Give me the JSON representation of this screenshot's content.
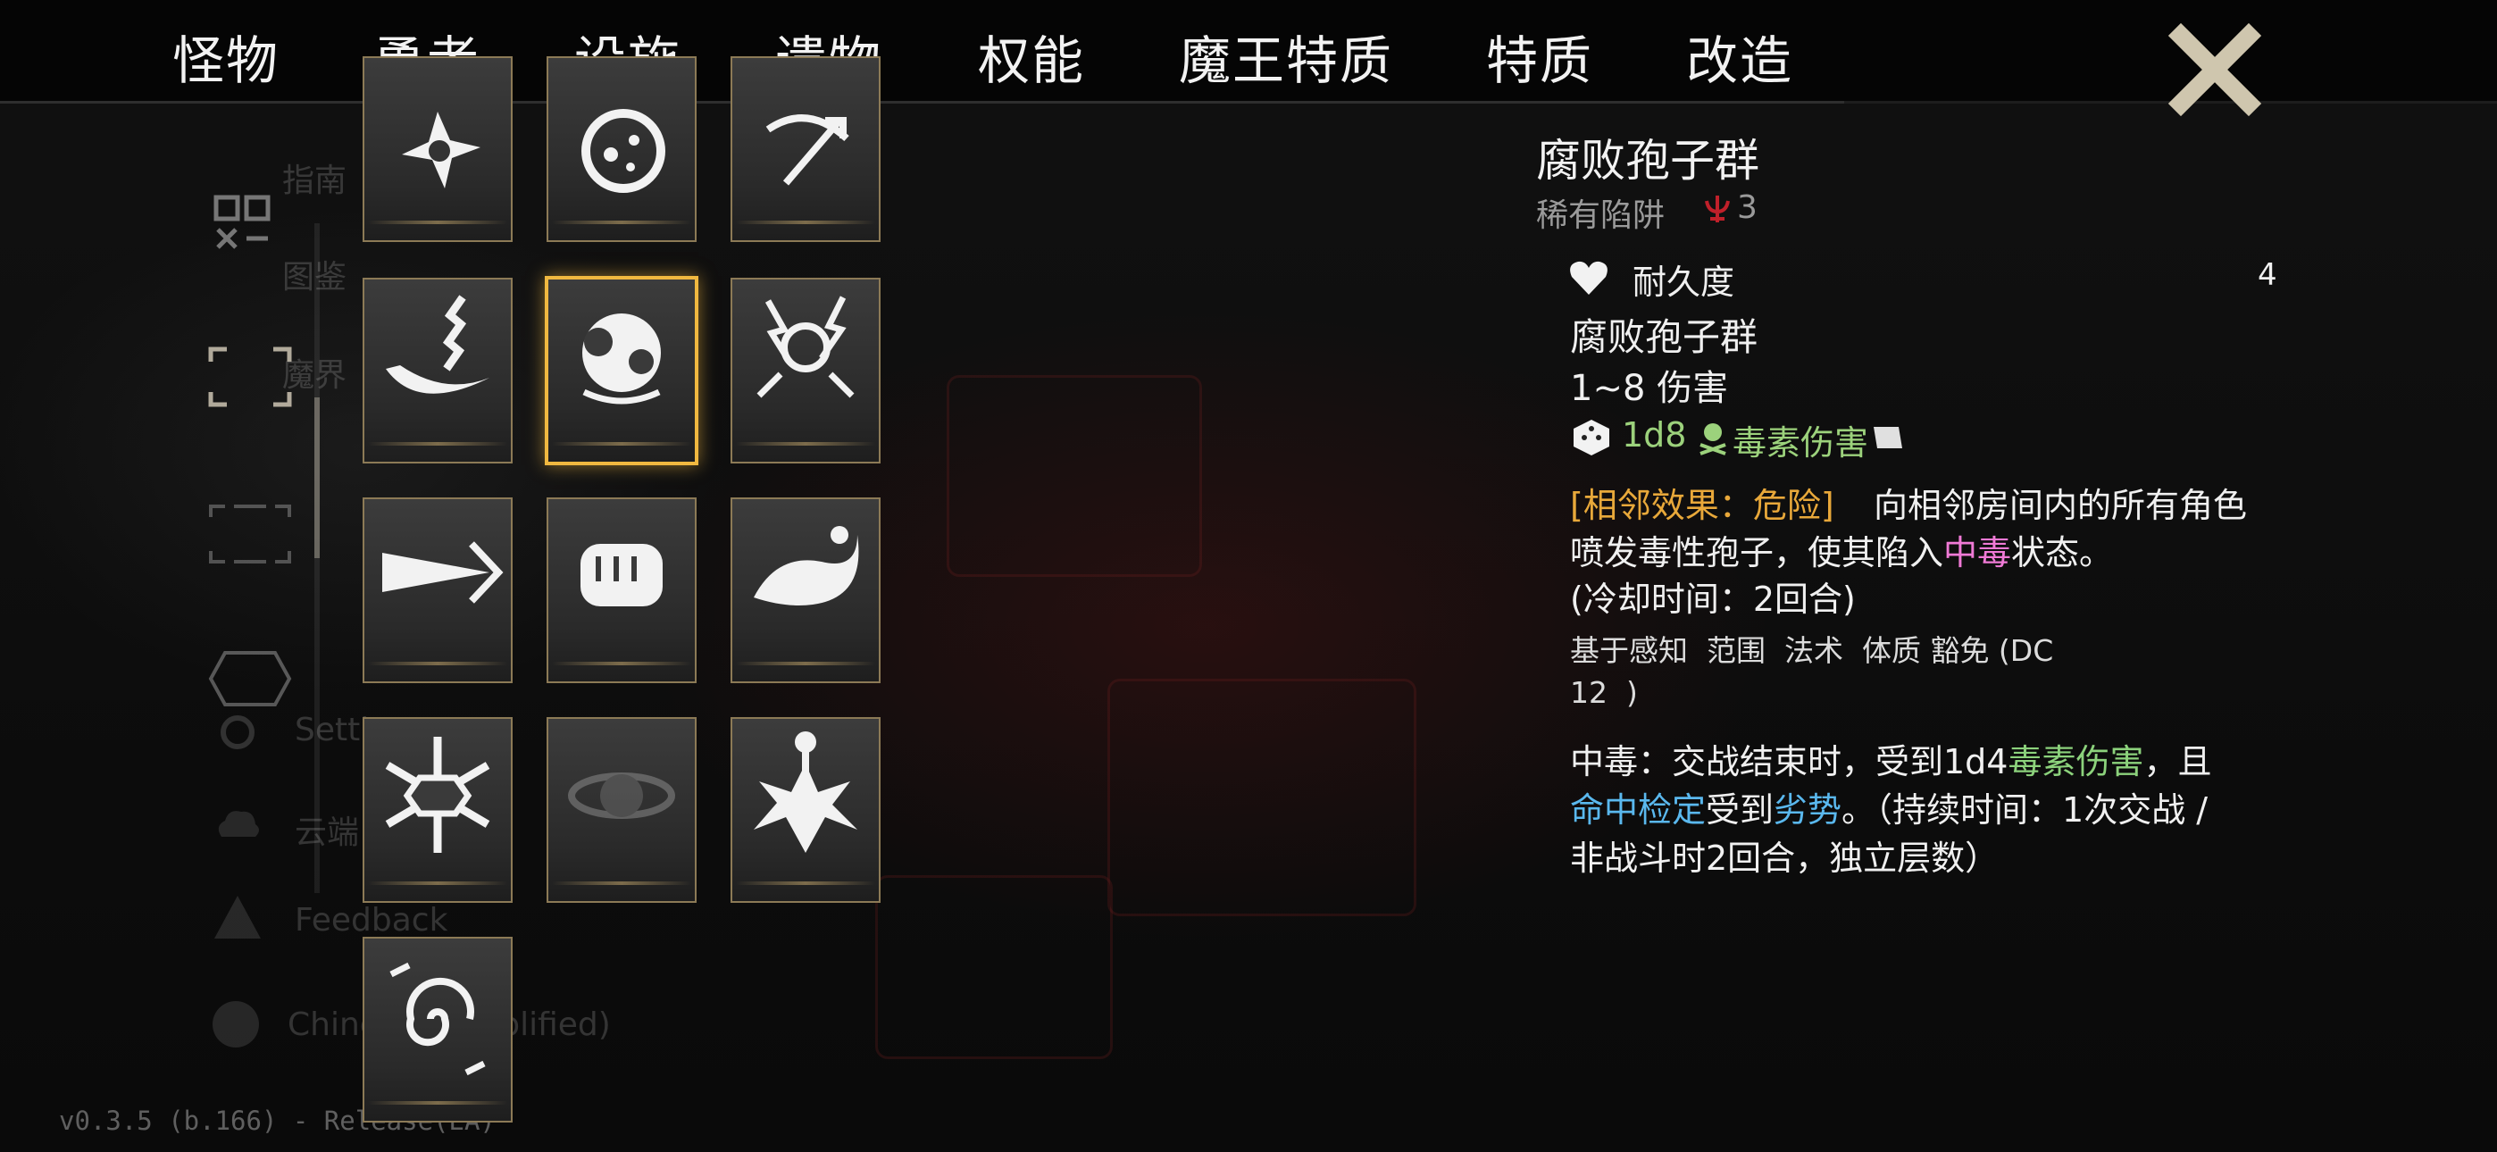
{
  "nav": {
    "tabs": [
      "怪物",
      "勇者",
      "设施",
      "遗物",
      "权能",
      "魔王特质",
      "特质",
      "改造"
    ],
    "active_tab": "设施"
  },
  "left_menu": {
    "items": [
      "指南",
      "图鉴",
      "魔界",
      "Settings",
      "云端",
      "Feedback",
      "Chinese (Simplified)"
    ]
  },
  "version": "v0.3.5 (b.166) - Release(EA)",
  "grid": {
    "icons": [
      "shuriken-trap-icon",
      "moon-orb-icon",
      "crossbow-icon",
      "chain-blade-icon",
      "spore-cloud-icon",
      "lightning-bolt-icon",
      "shockwave-icon",
      "fist-icon",
      "water-wave-icon",
      "snowflake-icon",
      "dark-vortex-icon",
      "explosion-icon",
      "spiral-portal-icon"
    ],
    "selected_index": 4
  },
  "detail": {
    "title": "腐败孢子群",
    "rarity": "稀有陷阱",
    "rarity_value": "3",
    "durability_label": "耐久度",
    "durability_value": "4",
    "attack_name": "腐败孢子群",
    "damage_text": "1~8 伤害",
    "dice": "1d8",
    "damage_type": "毒素伤害",
    "effect_tag": "[相邻效果：危险]",
    "effect_text_1": "向相邻房间内的所有角色",
    "effect_text_2a": "喷发毒性孢子，使其陷入",
    "effect_text_2b": "中毒",
    "effect_text_2c": "状态。",
    "cooldown": "(冷却时间：2回合)",
    "tag_perception": "基于感知",
    "tag_area": "范围",
    "tag_spell": "法术",
    "tag_save": "体质 豁免 (DC",
    "tag_save_dc": "12",
    "tag_close": ")",
    "poison_prefix": "中毒：交战结束时，受到1d4",
    "poison_dmg": "毒素伤害",
    "poison_suffix": "，且",
    "hit_check": "命中检定",
    "hit_mid": "受到",
    "disadvantage": "劣势",
    "hit_end": "。（持续时间：1次交战 /",
    "duration_end": "非战斗时2回合，独立层数）"
  },
  "colors": {
    "accent_gold": "#e8a83a",
    "selected_border": "#f0b840",
    "slot_border": "#8c7a56",
    "poison_green": "#9cd27c",
    "status_pink": "#f07ad6",
    "keyword_blue": "#5ab8ee",
    "rarity_red": "#c0202a"
  }
}
